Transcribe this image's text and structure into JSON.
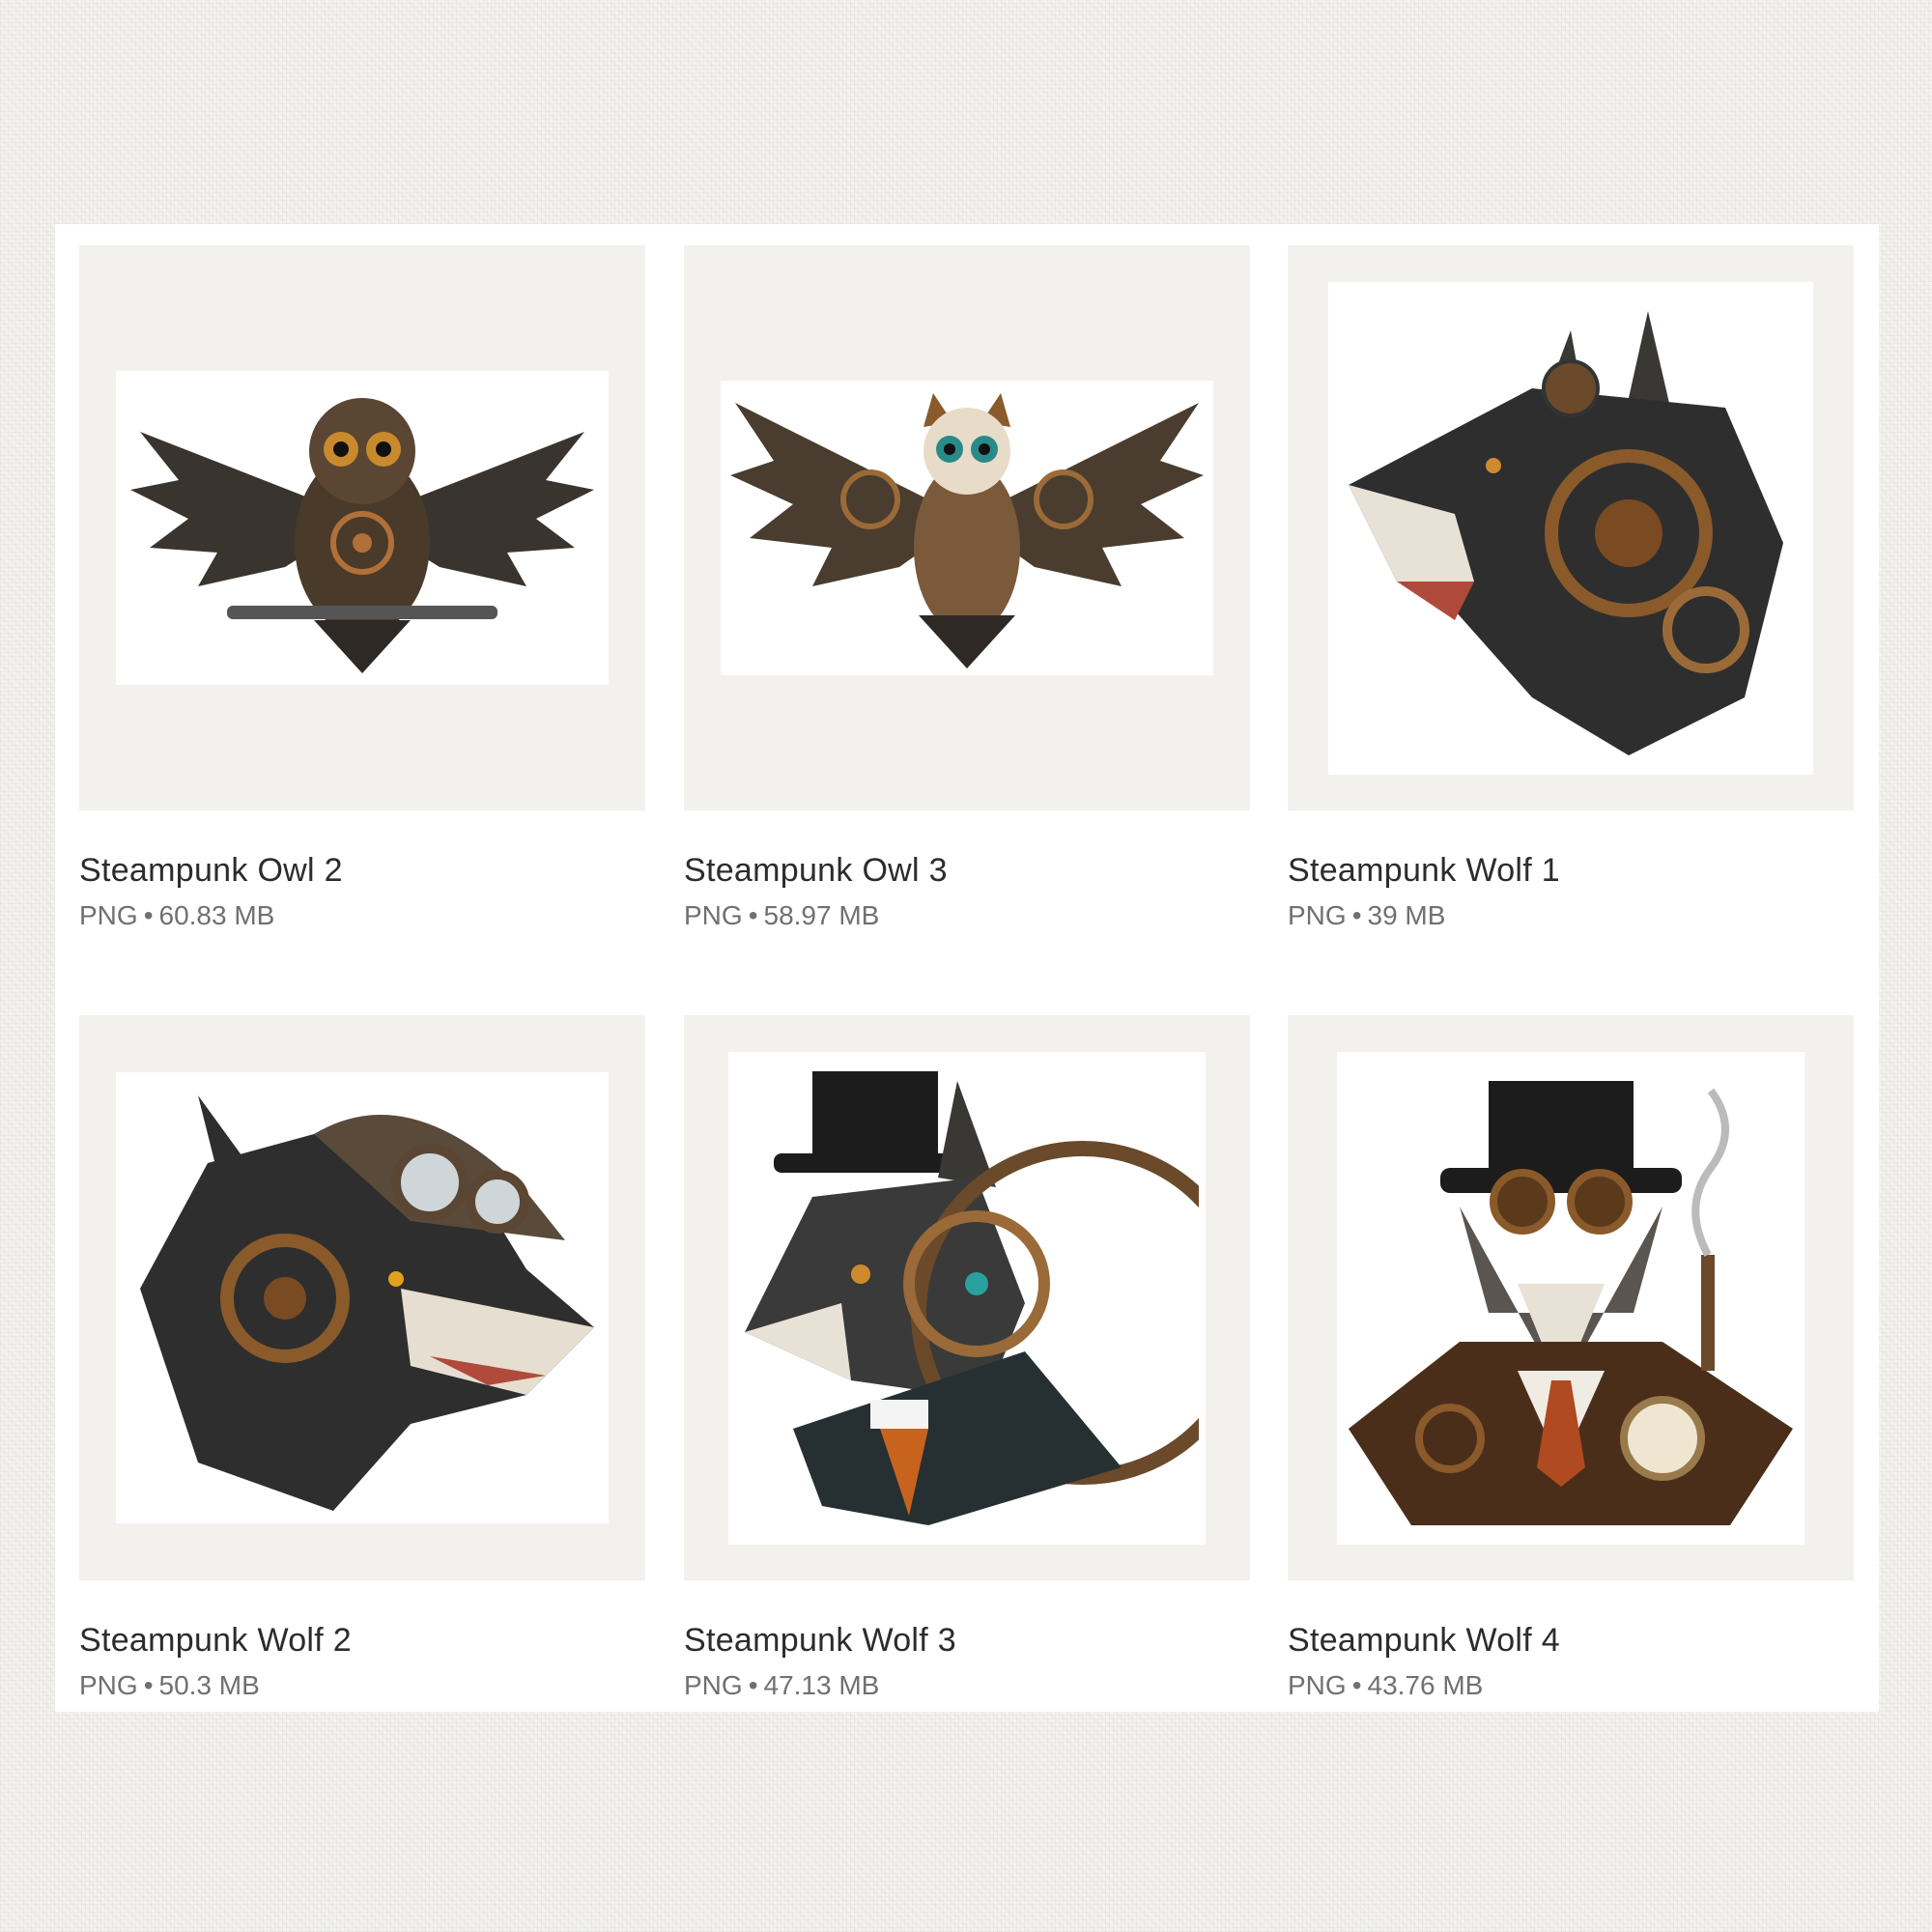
{
  "items": [
    {
      "title": "Steampunk Owl 2",
      "format": "PNG",
      "size": "60.83 MB",
      "art": "steampunk-owl-wings-spread"
    },
    {
      "title": "Steampunk Owl 3",
      "format": "PNG",
      "size": "58.97 MB",
      "art": "steampunk-owl-wings-spread"
    },
    {
      "title": "Steampunk Wolf 1",
      "format": "PNG",
      "size": "39 MB",
      "art": "steampunk-wolf-head-snarling"
    },
    {
      "title": "Steampunk Wolf 2",
      "format": "PNG",
      "size": "50.3 MB",
      "art": "steampunk-wolf-head-helmet-goggles"
    },
    {
      "title": "Steampunk Wolf 3",
      "format": "PNG",
      "size": "47.13 MB",
      "art": "steampunk-wolf-top-hat-suit"
    },
    {
      "title": "Steampunk Wolf 4",
      "format": "PNG",
      "size": "43.76 MB",
      "art": "steampunk-wolf-top-hat-pocket-watch"
    }
  ],
  "separator": "•",
  "colors": {
    "background": "#f1f0ec",
    "panel": "#ffffff",
    "thumb_bg": "#f2f1ed",
    "bronze": "#8a5a2b",
    "fur": "#2e2e2e"
  }
}
